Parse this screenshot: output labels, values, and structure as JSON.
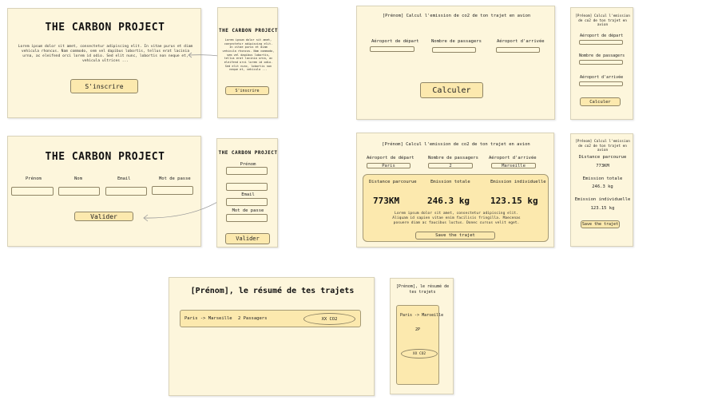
{
  "project_title": "THE CARBON PROJECT",
  "lorem_home": "Lorem ipsum dolor sit amet, consectetur adipiscing elit. In vitae purus et diam vehicula rhoncus. Nam commodo, sem vel dapibus lobortis, tellus erat lacinia urna, ac eleifend orci lorem id odio. Sed elit nunc, lobortis non neque et, vehicula ultrices ...",
  "lorem_home_mobile": "Lorem ipsum dolor sit amet, consectetur adipiscing elit. In vitae purus et diam vehicula rhoncus. Nam commodo, sem vel dapibus lobortis, tellus erat lacinia urna, ac eleifend orci lorem id odio. Sed elit nunc, lobortis non neque et, vehicula ...",
  "signup_button": "S'inscrire",
  "form": {
    "first_name": "Prénom",
    "last_name": "Nom",
    "email": "Email",
    "password": "Mot de passe",
    "submit": "Valider"
  },
  "calc": {
    "heading": "[Prénom] Calcul l'emission de co2 de ton trajet en avion",
    "departure": "Aéroport de départ",
    "passengers": "Nombre de passagers",
    "arrival": "Aéroport d'arrivée",
    "submit": "Calculer"
  },
  "result": {
    "heading": "[Prénom] Calcul l'emission de co2 de ton trajet en avion",
    "departure_value": "Paris",
    "passengers_value": "2",
    "arrival_value": "Marseille",
    "distance_label": "Distance parcourue",
    "total_label": "Emission totale",
    "individual_label": "Emission individuelle",
    "distance_value": "773KM",
    "total_value": "246.3 kg",
    "individual_value": "123.15 kg",
    "lorem": "Lorem ipsum dolor sit amet, consectetur adipiscing elit. Aliquam id sapien vitae enim facilisis fringilla. Maecenas posuere diam ac faucibus luctus. Donec cursus velit eget.",
    "save": "Save the trajet"
  },
  "summary": {
    "heading": "[Prénom], le résumé de tes trajets",
    "heading_mobile": "[Prénom], le résumé de tes trajets",
    "route": "Paris -> Marseille",
    "passengers": "2 Passagers",
    "passengers_mobile": "2P",
    "co2": "XX CO2",
    "co2_mobile": "XX CO2"
  }
}
